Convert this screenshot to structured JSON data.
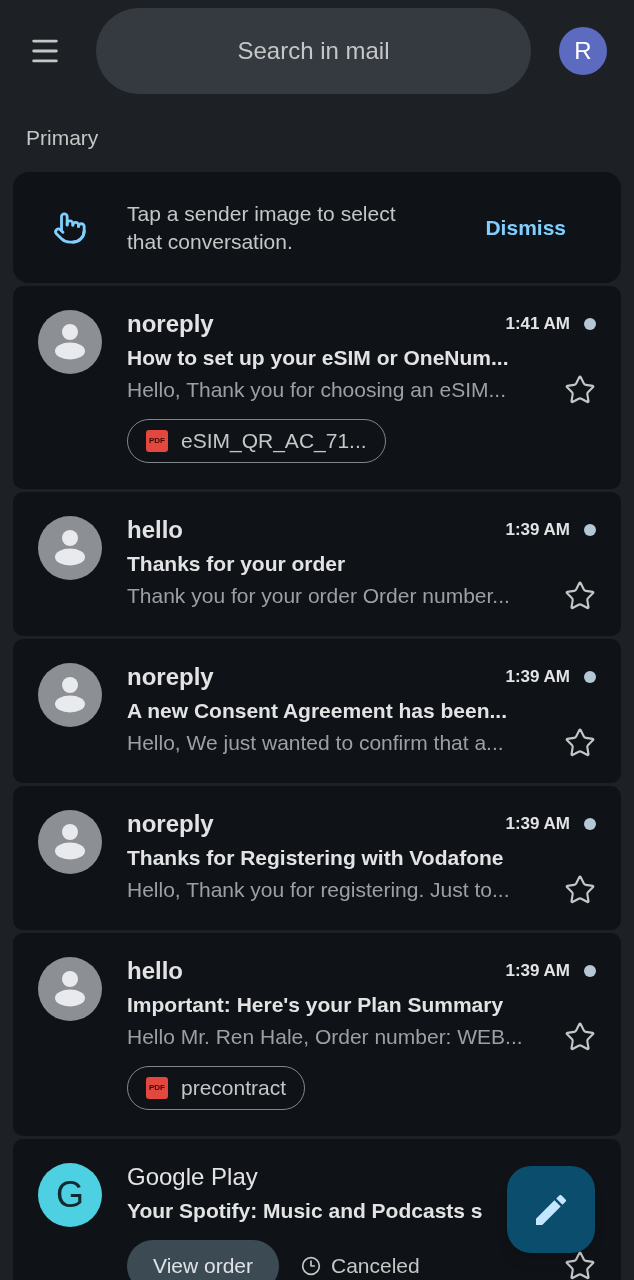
{
  "top_bar": {
    "search": {
      "placeholder": "Search in mail"
    },
    "account": {
      "initial": "R"
    }
  },
  "section_title": "Primary",
  "tip": {
    "text": "Tap a sender image to select that conversation.",
    "action": "Dismiss"
  },
  "emails": [
    {
      "avatar": {
        "kind": "silhouette"
      },
      "sender": "noreply",
      "time": "1:41 AM",
      "unread": true,
      "subject": "How to set up your eSIM or OneNum...",
      "snippet": "Hello, Thank you for choosing an eSIM...",
      "starred": false,
      "attachments": [
        {
          "kind": "pdf",
          "icon_label": "PDF",
          "name": "eSIM_QR_AC_71..."
        }
      ]
    },
    {
      "avatar": {
        "kind": "silhouette"
      },
      "sender": "hello",
      "time": "1:39 AM",
      "unread": true,
      "subject": "Thanks for your order",
      "snippet": "Thank you for your order Order number...",
      "starred": false
    },
    {
      "avatar": {
        "kind": "silhouette"
      },
      "sender": "noreply",
      "time": "1:39 AM",
      "unread": true,
      "subject": "A new Consent Agreement has been...",
      "snippet": "Hello, We just wanted to confirm that a...",
      "starred": false
    },
    {
      "avatar": {
        "kind": "silhouette"
      },
      "sender": "noreply",
      "time": "1:39 AM",
      "unread": true,
      "subject": "Thanks for Registering with Vodafone",
      "snippet": "Hello, Thank you for registering. Just to...",
      "starred": false
    },
    {
      "avatar": {
        "kind": "silhouette"
      },
      "sender": "hello",
      "time": "1:39 AM",
      "unread": true,
      "subject": "Important: Here's your Plan Summary",
      "snippet": "Hello Mr. Ren Hale, Order number: WEB...",
      "starred": false,
      "attachments": [
        {
          "kind": "pdf",
          "icon_label": "PDF",
          "name": "precontract"
        }
      ]
    },
    {
      "avatar": {
        "kind": "letter",
        "letter": "G",
        "color": "#4dd0e1"
      },
      "sender": "Google Play",
      "unread": false,
      "subject": "Your Spotify: Music and Podcasts s",
      "starred": false,
      "actions": [
        {
          "kind": "button",
          "label": "View order"
        },
        {
          "kind": "status",
          "label": "Canceled"
        }
      ]
    }
  ]
}
